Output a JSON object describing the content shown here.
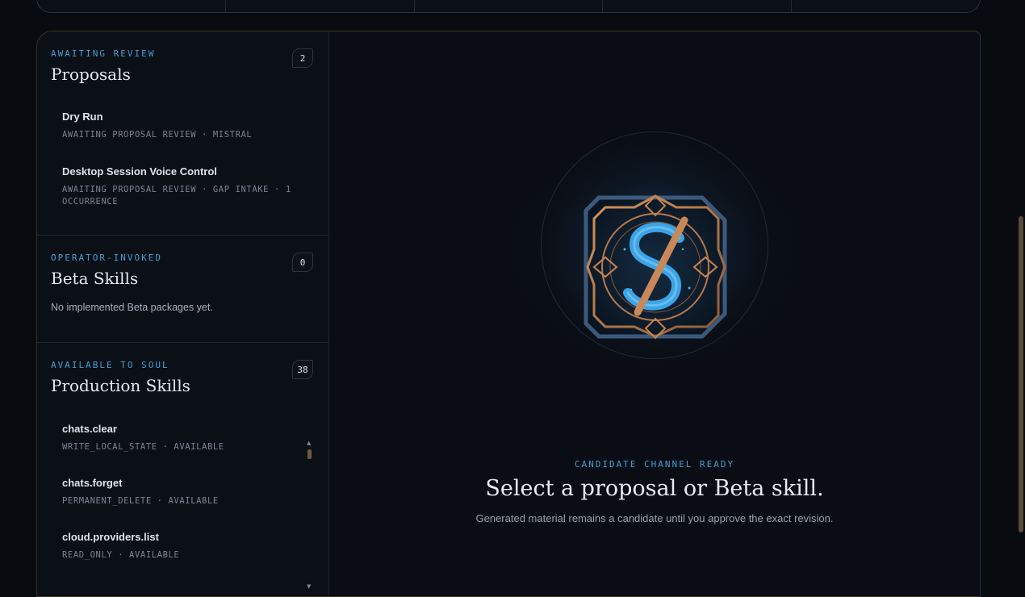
{
  "sidebar": {
    "proposals": {
      "eyebrow": "AWAITING REVIEW",
      "title": "Proposals",
      "count": "2",
      "items": [
        {
          "title": "Dry Run",
          "meta": "AWAITING PROPOSAL REVIEW · MISTRAL"
        },
        {
          "title": "Desktop Session Voice Control",
          "meta": "AWAITING PROPOSAL REVIEW · GAP INTAKE · 1 OCCURRENCE"
        }
      ]
    },
    "beta": {
      "eyebrow": "OPERATOR-INVOKED",
      "title": "Beta Skills",
      "count": "0",
      "empty": "No implemented Beta packages yet."
    },
    "production": {
      "eyebrow": "AVAILABLE TO SOUL",
      "title": "Production Skills",
      "count": "38",
      "items": [
        {
          "title": "chats.clear",
          "meta": "WRITE_LOCAL_STATE · AVAILABLE"
        },
        {
          "title": "chats.forget",
          "meta": "PERMANENT_DELETE · AVAILABLE"
        },
        {
          "title": "cloud.providers.list",
          "meta": "READ_ONLY · AVAILABLE"
        }
      ]
    }
  },
  "main": {
    "eyebrow": "CANDIDATE CHANNEL READY",
    "title": "Select a proposal or Beta skill.",
    "subtitle": "Generated material remains a candidate until you approve the exact revision."
  },
  "icons": {
    "emblem": "skill-sigil-icon",
    "scroll_up": "triangle-up-icon",
    "scroll_down": "triangle-down-icon"
  },
  "colors": {
    "accent": "#3fa0d8",
    "bronze": "#b8794a",
    "background": "#080b10"
  }
}
